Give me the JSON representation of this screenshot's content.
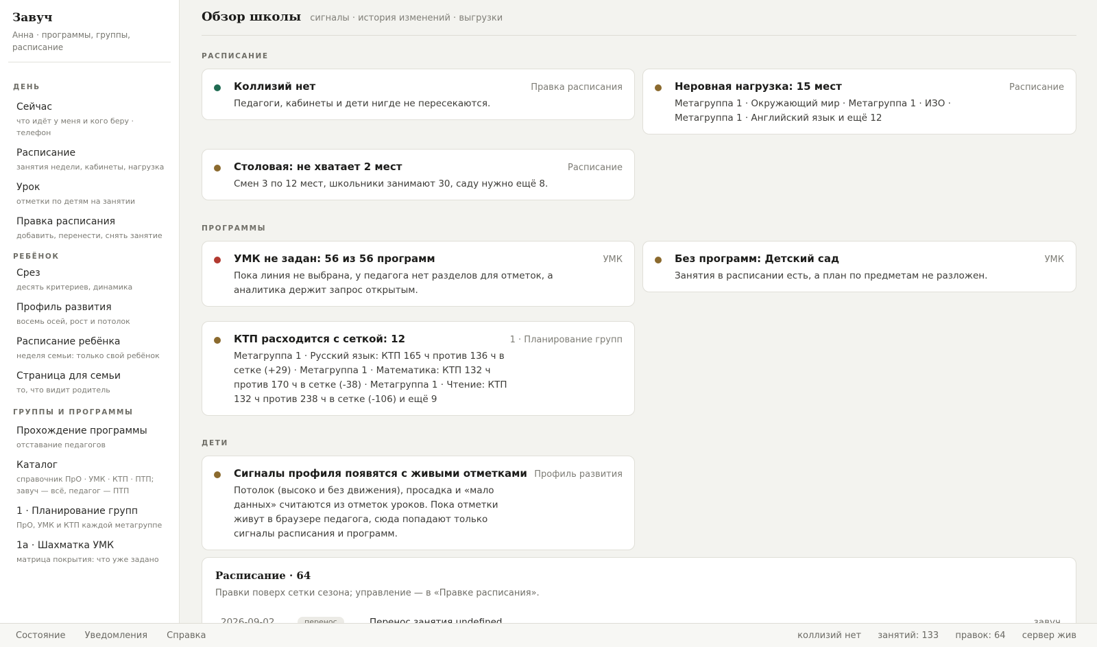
{
  "app": {
    "title": "Завуч",
    "subtitle": "Анна · программы, группы, расписание"
  },
  "sidebar": {
    "sections": [
      {
        "label": "ДЕНЬ",
        "items": [
          {
            "label": "Сейчас",
            "desc": "что идёт у меня и кого беру · телефон"
          },
          {
            "label": "Расписание",
            "desc": "занятия недели, кабинеты, нагрузка"
          },
          {
            "label": "Урок",
            "desc": "отметки по детям на занятии"
          },
          {
            "label": "Правка расписания",
            "desc": "добавить, перенести, снять занятие"
          }
        ]
      },
      {
        "label": "РЕБЁНОК",
        "items": [
          {
            "label": "Срез",
            "desc": "десять критериев, динамика"
          },
          {
            "label": "Профиль развития",
            "desc": "восемь осей, рост и потолок"
          },
          {
            "label": "Расписание ребёнка",
            "desc": "неделя семьи: только свой ребёнок"
          },
          {
            "label": "Страница для семьи",
            "desc": "то, что видит родитель"
          }
        ]
      },
      {
        "label": "ГРУППЫ И ПРОГРАММЫ",
        "items": [
          {
            "label": "Прохождение программы",
            "desc": "отставание педагогов"
          },
          {
            "label": "Каталог",
            "desc": "справочник ПрО · УМК · КТП · ПТП; завуч — всё, педагог — ПТП"
          },
          {
            "label": "1 · Планирование групп",
            "desc": "ПрО, УМК и КТП каждой метагруппе"
          },
          {
            "label": "1а · Шахматка УМК",
            "desc": "матрица покрытия: что уже задано"
          }
        ]
      }
    ]
  },
  "header": {
    "title": "Обзор школы",
    "subtitle": "сигналы · история изменений · выгрузки"
  },
  "sections": {
    "schedule": "РАСПИСАНИЕ",
    "programs": "ПРОГРАММЫ",
    "children": "ДЕТИ"
  },
  "colors": {
    "ok": "#1f6b52",
    "warn": "#8b6a2e",
    "error": "#b23a30"
  },
  "cards": {
    "collisions": {
      "status": "ok",
      "title": "Коллизий нет",
      "tag": "Правка расписания",
      "body": "Педагоги, кабинеты и дети нигде не пересекаются."
    },
    "load": {
      "status": "warn",
      "title": "Неровная нагрузка: 15 мест",
      "tag": "Расписание",
      "body": "Метагруппа 1 · Окружающий мир · Метагруппа 1 · ИЗО · Метагруппа 1 · Английский язык и ещё 12"
    },
    "canteen": {
      "status": "warn",
      "title": "Столовая: не хватает 2 мест",
      "tag": "Расписание",
      "body": "Смен 3 по 12 мест, школьники занимают 30, саду нужно ещё 8."
    },
    "umk": {
      "status": "error",
      "title": "УМК не задан: 56 из 56 программ",
      "tag": "УМК",
      "body": "Пока линия не выбрана, у педагога нет разделов для отметок, а аналитика держит запрос открытым."
    },
    "noprog": {
      "status": "warn",
      "title": "Без программ: Детский сад",
      "tag": "УМК",
      "body": "Занятия в расписании есть, а план по предметам не разложен."
    },
    "ktp": {
      "status": "warn",
      "title": "КТП расходится с сеткой: 12",
      "tag": "1 · Планирование групп",
      "body": "Метагруппа 1 · Русский язык: КТП 165 ч против 136 ч в сетке (+29) · Метагруппа 1 · Математика: КТП 132 ч против 170 ч в сетке (-38) · Метагруппа 1 · Чтение: КТП 132 ч против 238 ч в сетке (-106) и ещё 9"
    },
    "profile": {
      "status": "warn",
      "title": "Сигналы профиля появятся с живыми отметками",
      "tag": "Профиль развития",
      "body": "Потолок (высоко и без движения), просадка и «мало данных» считаются из отметок уроков. Пока отметки живут в браузере педагога, сюда попадают только сигналы расписания и программ."
    }
  },
  "history": {
    "title": "Расписание · 64",
    "subtitle": "Правки поверх сетки сезона; управление — в «Правке расписания».",
    "rows": [
      {
        "date": "2026-09-02",
        "badge": "перенос",
        "text": "Перенос занятия undefined",
        "who": "завуч"
      }
    ]
  },
  "footer": {
    "links": [
      "Состояние",
      "Уведомления",
      "Справка"
    ],
    "stats": [
      "коллизий нет",
      "занятий: 133",
      "правок: 64",
      "сервер жив"
    ]
  }
}
